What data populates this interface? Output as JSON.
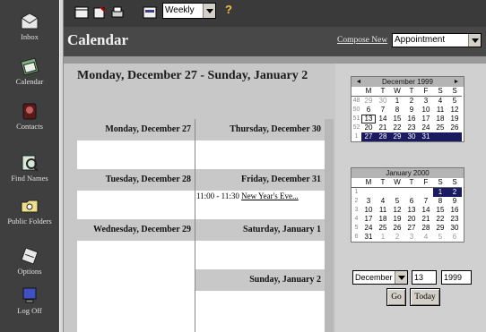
{
  "nav": {
    "items": [
      {
        "label": "Inbox",
        "icon": "inbox-icon"
      },
      {
        "label": "Calendar",
        "icon": "calendar-icon"
      },
      {
        "label": "Contacts",
        "icon": "contacts-icon"
      },
      {
        "label": "Find Names",
        "icon": "find-names-icon"
      },
      {
        "label": "Public Folders",
        "icon": "public-folders-icon"
      },
      {
        "label": "Options",
        "icon": "options-icon"
      },
      {
        "label": "Log Off",
        "icon": "log-off-icon"
      }
    ]
  },
  "toolbar": {
    "view_value": "Weekly",
    "help_label": "?"
  },
  "header": {
    "title": "Calendar",
    "compose_label": "Compose New",
    "compose_value": "Appointment"
  },
  "week": {
    "range_title": "Monday, December 27 - Sunday, January 2",
    "days": [
      {
        "label": "Monday, December 27"
      },
      {
        "label": "Thursday, December 30"
      },
      {
        "label": "Tuesday, December 28"
      },
      {
        "label": "Friday, December 31"
      },
      {
        "label": "Wednesday, December 29"
      },
      {
        "label": "Saturday, January 1"
      },
      {
        "label": "Sunday, January 2"
      }
    ],
    "event": {
      "time": "11:00 - 11:30",
      "title": "New Year's Eve..."
    }
  },
  "minical_dec": {
    "title": "December 1999",
    "prev": "◄",
    "next": "►",
    "dow": [
      "M",
      "T",
      "W",
      "T",
      "F",
      "S",
      "S"
    ],
    "weeks": [
      {
        "wk": "48",
        "days": [
          "29",
          "30",
          "1",
          "2",
          "3",
          "4",
          "5"
        ]
      },
      {
        "wk": "50",
        "days": [
          "6",
          "7",
          "8",
          "9",
          "10",
          "11",
          "12"
        ]
      },
      {
        "wk": "51",
        "days": [
          "13",
          "14",
          "15",
          "16",
          "17",
          "18",
          "19"
        ]
      },
      {
        "wk": "52",
        "days": [
          "20",
          "21",
          "22",
          "23",
          "24",
          "25",
          "26"
        ]
      },
      {
        "wk": "1",
        "days": [
          "27",
          "28",
          "29",
          "30",
          "31",
          "",
          ""
        ]
      }
    ]
  },
  "minical_jan": {
    "title": "January 2000",
    "dow": [
      "M",
      "T",
      "W",
      "T",
      "F",
      "S",
      "S"
    ],
    "weeks": [
      {
        "wk": "1",
        "days": [
          "",
          "",
          "",
          "",
          "",
          "1",
          "2"
        ]
      },
      {
        "wk": "2",
        "days": [
          "3",
          "4",
          "5",
          "6",
          "7",
          "8",
          "9"
        ]
      },
      {
        "wk": "3",
        "days": [
          "10",
          "11",
          "12",
          "13",
          "14",
          "15",
          "16"
        ]
      },
      {
        "wk": "4",
        "days": [
          "17",
          "18",
          "19",
          "20",
          "21",
          "22",
          "23"
        ]
      },
      {
        "wk": "5",
        "days": [
          "24",
          "25",
          "26",
          "27",
          "28",
          "29",
          "30"
        ]
      },
      {
        "wk": "6",
        "days": [
          "31",
          "1",
          "2",
          "3",
          "4",
          "5",
          "6"
        ]
      }
    ]
  },
  "goto": {
    "month": "December",
    "day": "13",
    "year": "1999",
    "go_label": "Go",
    "today_label": "Today"
  },
  "colors": {
    "nav_bg": "#3f3f3f",
    "selection": "#1a1a60"
  }
}
